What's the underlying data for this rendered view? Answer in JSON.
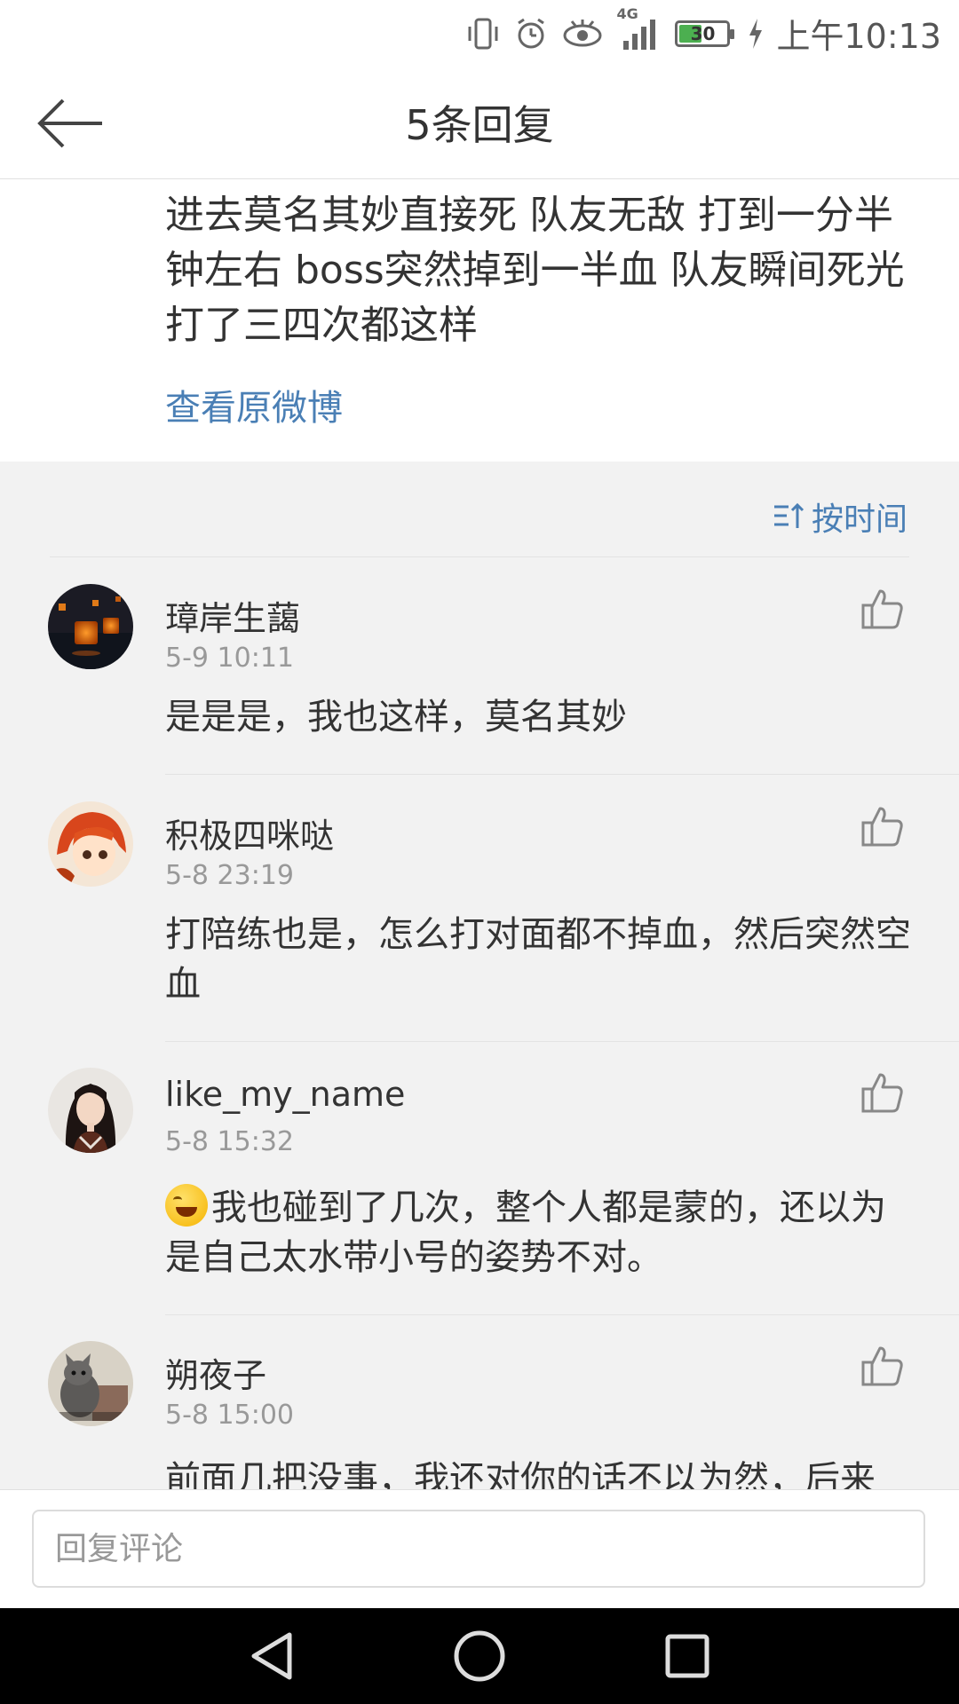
{
  "status_bar": {
    "time": "上午10:13",
    "battery": "30",
    "network": "4G",
    "icons": [
      "vibrate-icon",
      "alarm-icon",
      "eye-icon",
      "signal-icon",
      "battery-icon",
      "charging-icon"
    ]
  },
  "header": {
    "title": "5条回复",
    "back_icon": "arrow-left-icon"
  },
  "post": {
    "text": "进去莫名其妙直接死 队友无敌 打到一分半钟左右  boss突然掉到一半血 队友瞬间死光 打了三四次都这样",
    "view_original": "查看原微博"
  },
  "sort": {
    "label": "按时间",
    "icon": "sort-icon"
  },
  "comments": [
    {
      "name": "璋岸生藹",
      "time": "5-9 10:11",
      "text": "是是是，我也这样，莫名其妙",
      "avatar": "lanterns-avatar"
    },
    {
      "name": "积极四咪哒",
      "time": "5-8 23:19",
      "text": "打陪练也是，怎么打对面都不掉血，然后突然空血",
      "avatar": "anime-girl-avatar"
    },
    {
      "name": "like_my_name",
      "time": "5-8 15:32",
      "text": "我也碰到了几次，整个人都是蒙的，还以为是自己太水带小号的姿势不对。",
      "avatar": "woman-avatar",
      "emoji": "laughing-tears-emoji"
    },
    {
      "name": "朔夜子",
      "time": "5-8 15:00",
      "text": "前面几把没事，我还对你的话不以为然，后来",
      "avatar": "cat-avatar"
    }
  ],
  "reply": {
    "placeholder": "回复评论"
  },
  "nav": {
    "back": "triangle-back-icon",
    "home": "circle-home-icon",
    "recents": "square-recents-icon"
  },
  "colors": {
    "link": "#4a7fb5",
    "background": "#f2f2f2",
    "battery_green": "#4caf50"
  }
}
